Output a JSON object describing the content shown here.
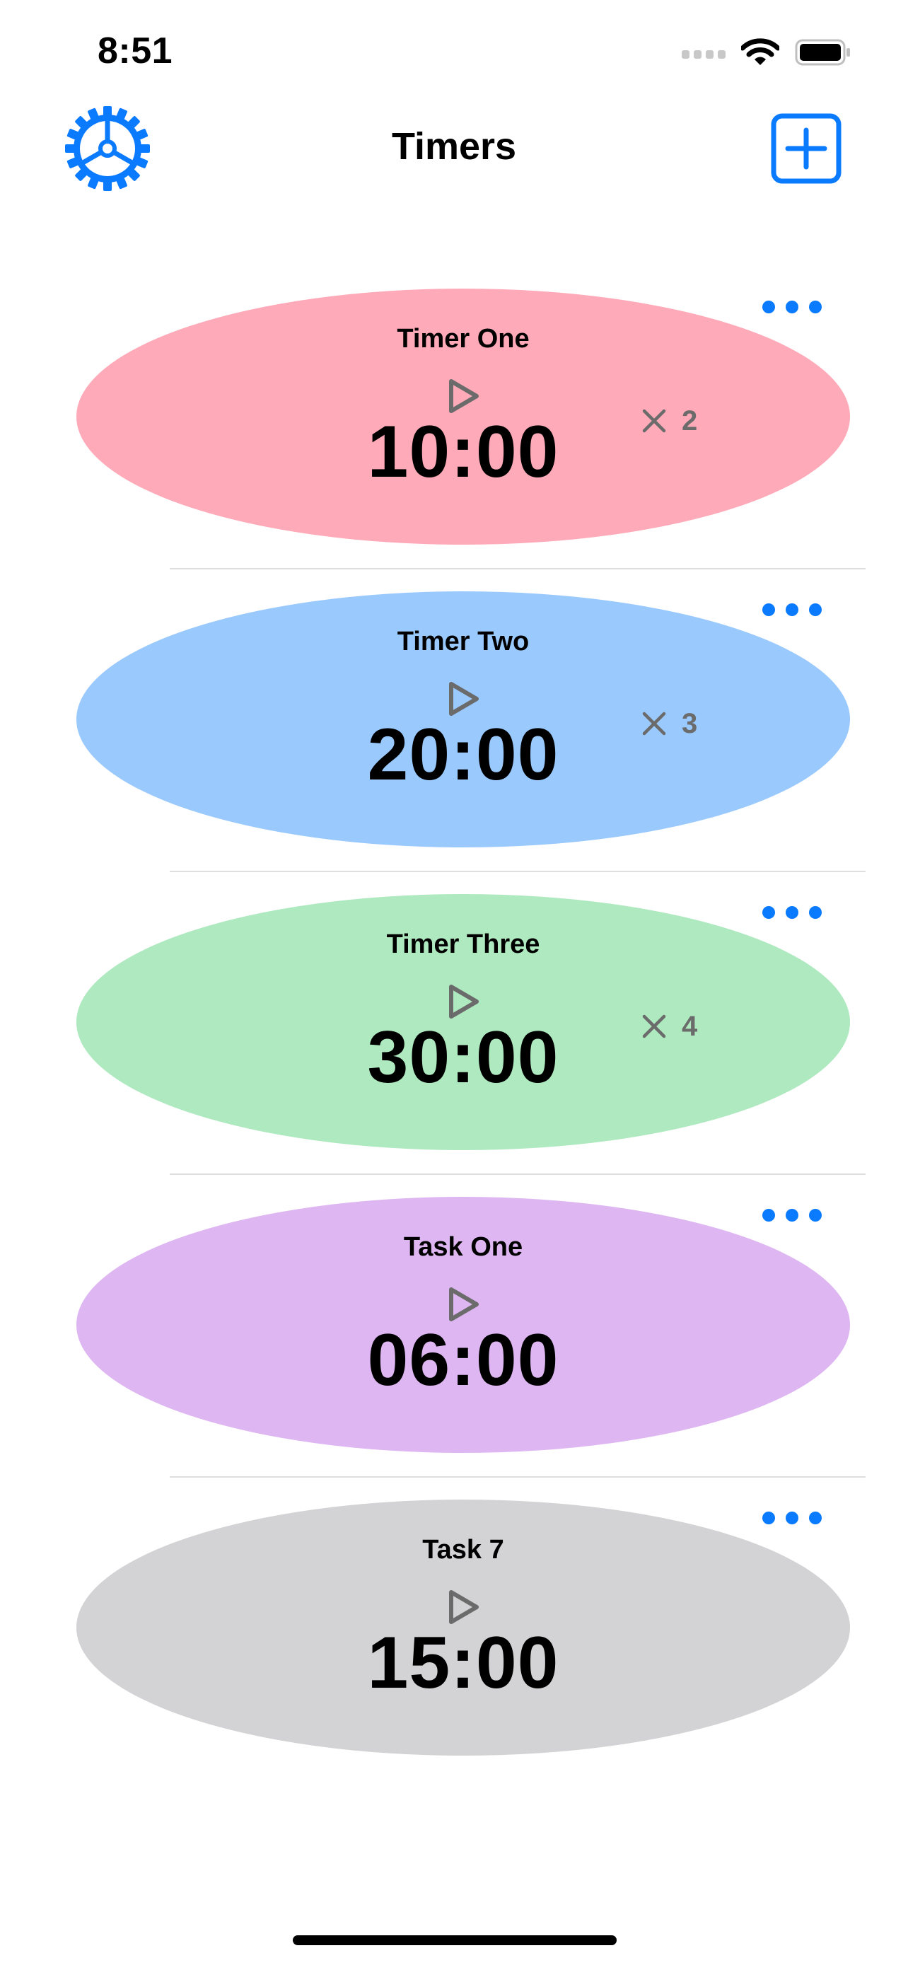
{
  "status_bar": {
    "time": "8:51"
  },
  "nav": {
    "title": "Timers",
    "settings_icon": "gear-icon",
    "add_icon": "plus-square-icon",
    "accent_color": "#0a7aff"
  },
  "timers": [
    {
      "name": "Timer One",
      "time": "10:00",
      "repeat": "2",
      "color": "#ffaab9"
    },
    {
      "name": "Timer Two",
      "time": "20:00",
      "repeat": "3",
      "color": "#9ac9fd"
    },
    {
      "name": "Timer Three",
      "time": "30:00",
      "repeat": "4",
      "color": "#aee9bf"
    },
    {
      "name": "Task One",
      "time": "06:00",
      "repeat": null,
      "color": "#deb7f2"
    },
    {
      "name": "Task 7",
      "time": "15:00",
      "repeat": null,
      "color": "#d3d3d5"
    }
  ]
}
